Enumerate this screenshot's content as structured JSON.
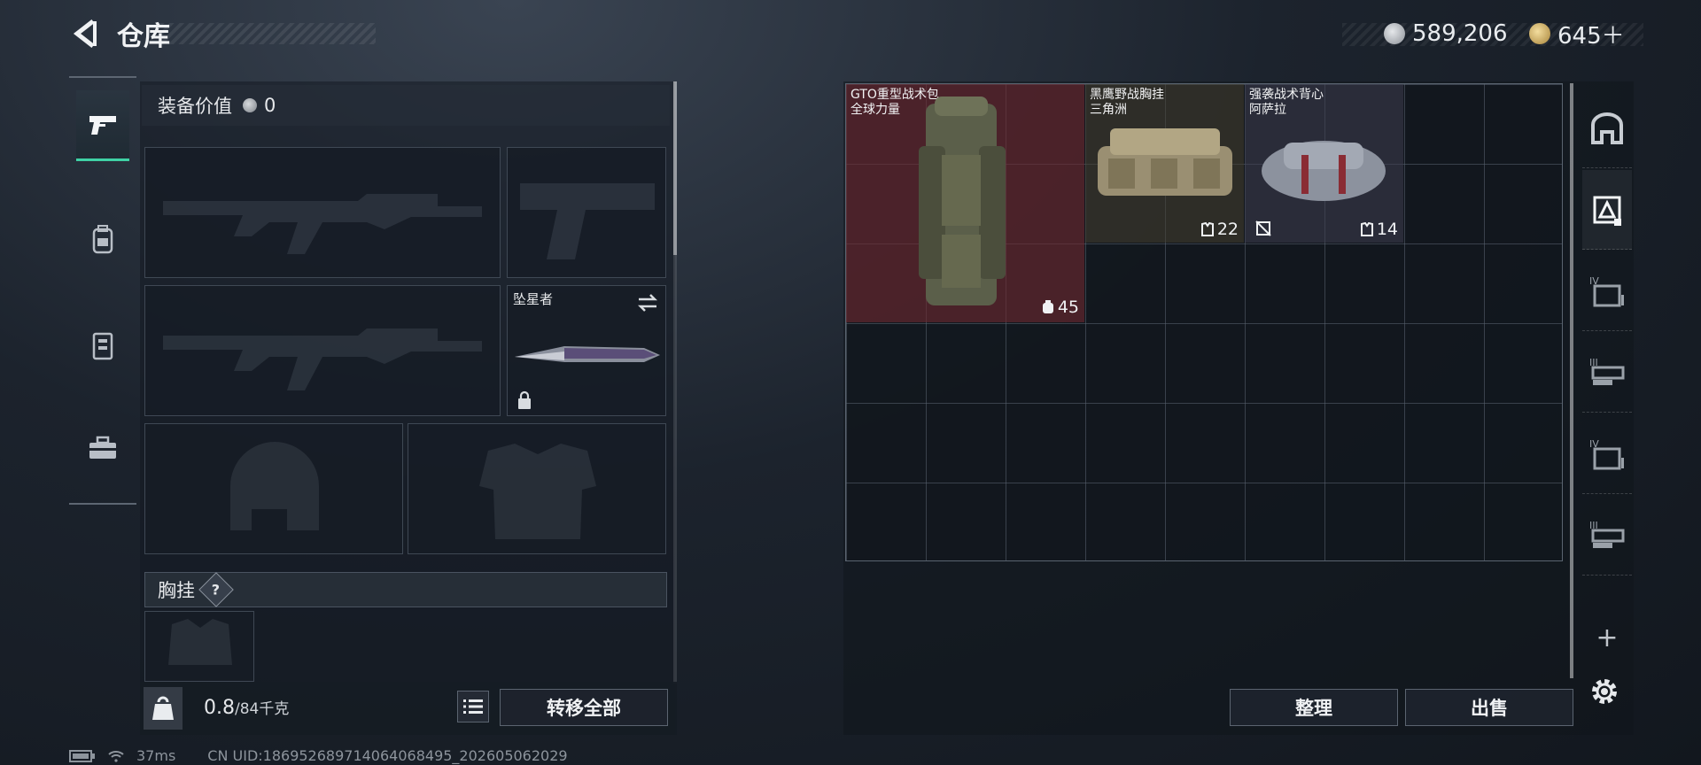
{
  "header": {
    "title": "仓库",
    "currency_silver": "589,206",
    "currency_gold": "645＋"
  },
  "nav": {
    "items": [
      "weapons-tab",
      "backpack-tab",
      "vest-tab",
      "toolbox-tab"
    ],
    "active": "weapons-tab"
  },
  "equipment": {
    "value_label": "装备价值",
    "value": "0",
    "melee_name": "坠星者",
    "section_title": "胸挂",
    "section_help": "?"
  },
  "footer": {
    "weight_icon_text": "KG",
    "weight_current": "0.8",
    "weight_max": "/84千克",
    "transfer_all": "转移全部",
    "organize": "整理",
    "sell": "出售"
  },
  "storage": {
    "items": [
      {
        "name": "GTO重型战术包",
        "source": "全球力量",
        "badge": "45",
        "bg": "#5a2a30"
      },
      {
        "name": "黑鹰野战胸挂",
        "source": "三角洲",
        "badge": "22",
        "bg": "#3e3a2e"
      },
      {
        "name": "强袭战术背心",
        "source": "阿萨拉",
        "badge": "14",
        "bg": "#3a3a4a"
      }
    ]
  },
  "right_tabs": [
    "home-icon",
    "storage-a-icon",
    "storage-iv-icon",
    "storage-iii-icon",
    "storage-iv-icon-2",
    "storage-iii-icon-2"
  ],
  "right_tab_numerals": [
    "IV",
    "III",
    "IV",
    "III"
  ],
  "status": {
    "ping": "37ms",
    "uid": "CN UID:1869526897140640684​95_202605062029"
  },
  "colors": {
    "accent": "#3fd1a5",
    "item_red": "#5a2a30"
  }
}
